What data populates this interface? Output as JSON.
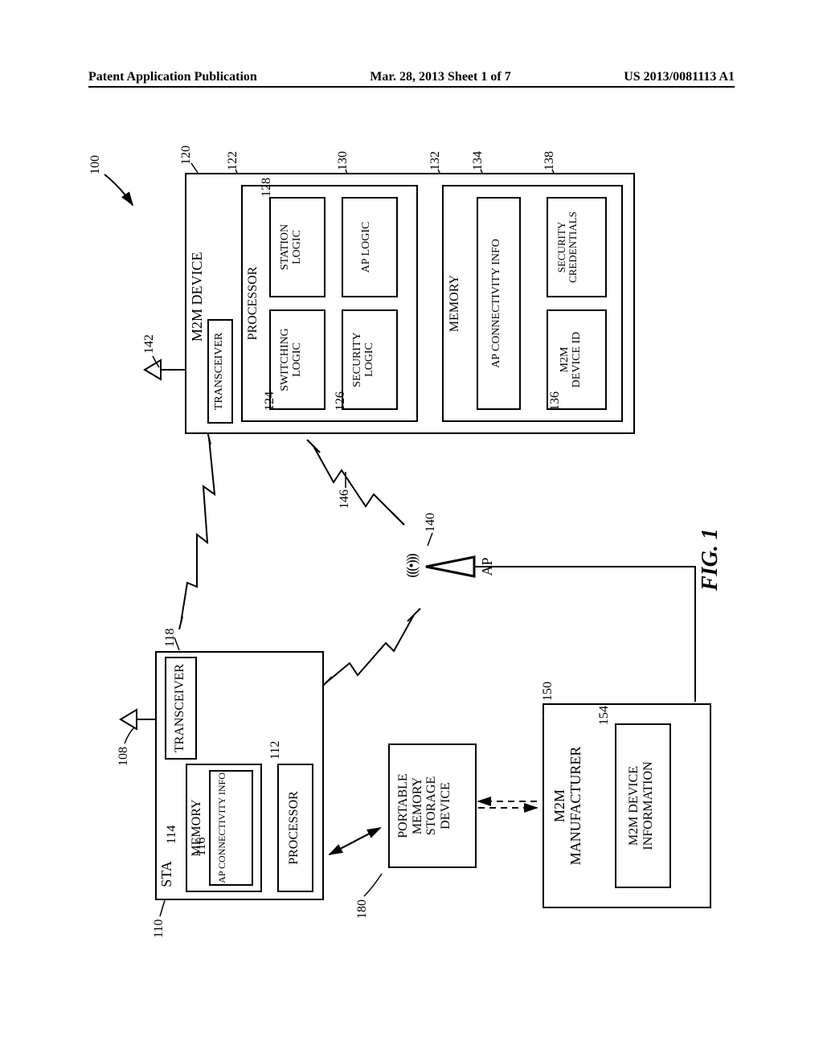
{
  "header": {
    "left": "Patent Application Publication",
    "center": "Mar. 28, 2013  Sheet 1 of 7",
    "right": "US 2013/0081113 A1"
  },
  "ref": {
    "r100": "100",
    "r108": "108",
    "r110": "110",
    "r112": "112",
    "r114": "114",
    "r116": "116",
    "r118": "118",
    "r120": "120",
    "r122": "122",
    "r124": "124",
    "r126": "126",
    "r128": "128",
    "r130": "130",
    "r132": "132",
    "r134": "134",
    "r136": "136",
    "r138": "138",
    "r140": "140",
    "r142": "142",
    "r146": "146",
    "r150": "150",
    "r154": "154",
    "r180": "180"
  },
  "labels": {
    "sta": "STA",
    "transceiver": "TRANSCEIVER",
    "memory": "MEMORY",
    "ap_conn": "AP CONNECTIVITY INFO",
    "processor": "PROCESSOR",
    "portable": "PORTABLE\nMEMORY\nSTORAGE\nDEVICE",
    "m2m_mfr": "M2M\nMANUFACTURER",
    "m2m_dev_info": "M2M DEVICE\nINFORMATION",
    "ap": "AP",
    "m2m_device": "M2M DEVICE",
    "switching": "SWITCHING\nLOGIC",
    "security_logic": "SECURITY\nLOGIC",
    "station_logic": "STATION\nLOGIC",
    "ap_logic": "AP LOGIC",
    "m2m_id": "M2M\nDEVICE ID",
    "sec_cred": "SECURITY\nCREDENTIALS",
    "fig": "FIG. 1",
    "radio": "(((•)))"
  }
}
